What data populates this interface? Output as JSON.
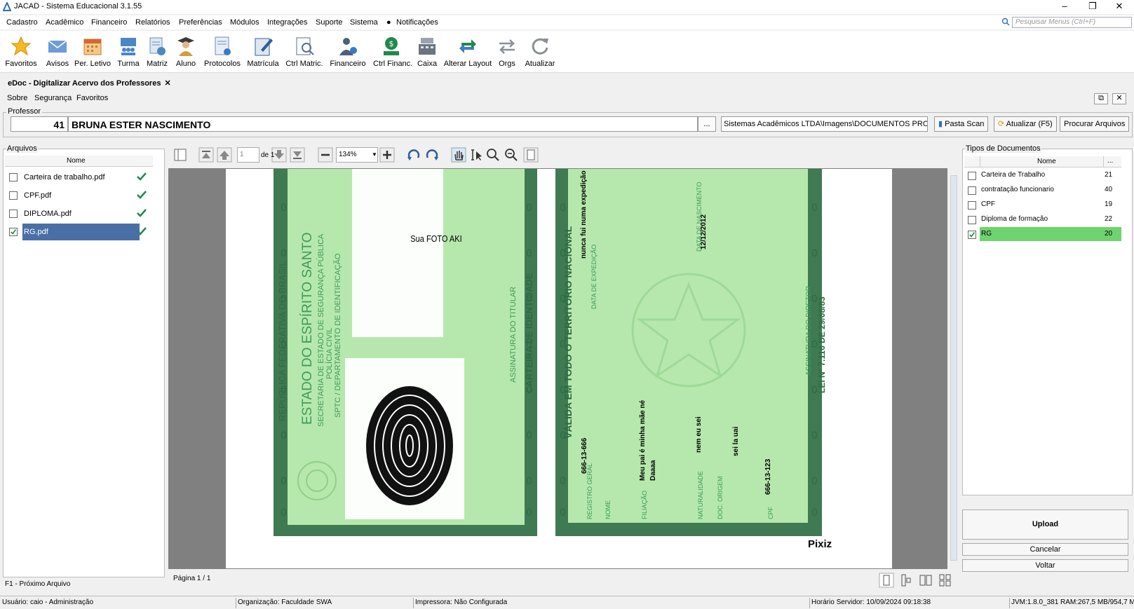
{
  "window": {
    "title": "JACAD - Sistema Educacional 3.1.55",
    "minimize": "–",
    "maximize": "❐",
    "close": "✕"
  },
  "menu": {
    "items": [
      "Cadastro",
      "Acadêmico",
      "Financeiro",
      "Relatórios",
      "Preferências",
      "Módulos",
      "Integrações",
      "Suporte",
      "Sistema",
      "Notificações"
    ],
    "search_placeholder": "Pesquisar Menus (Ctrl+F)"
  },
  "toolbar": [
    "Favoritos",
    "Avisos",
    "Per. Letivo",
    "Turma",
    "Matriz",
    "Aluno",
    "Protocolos",
    "Matrícula",
    "Ctrl Matric.",
    "Financeiro",
    "Ctrl Financ.",
    "Caixa",
    "Alterar Layout",
    "Orgs",
    "Atualizar"
  ],
  "tab": {
    "label": "eDoc - Digitalizar Acervo dos Professores",
    "close": "✕"
  },
  "submenu": [
    "Sobre",
    "Segurança",
    "Favoritos"
  ],
  "professor": {
    "legend": "Professor",
    "id": "41",
    "name": "BRUNA ESTER NASCIMENTO",
    "dots": "...",
    "path": "Sistemas Acadêmicos LTDA\\Imagens\\DOCUMENTOS PROFESSOR",
    "btn_pasta": "Pasta Scan",
    "btn_atualizar": "Atualizar (F5)",
    "btn_procurar": "Procurar Arquivos"
  },
  "arquivos": {
    "legend": "Arquivos",
    "header": "Nome",
    "files": [
      {
        "name": "Carteira de trabalho.pdf",
        "checked": false,
        "selected": false
      },
      {
        "name": "CPF.pdf",
        "checked": false,
        "selected": false
      },
      {
        "name": "DIPLOMA.pdf",
        "checked": false,
        "selected": false
      },
      {
        "name": "RG.pdf",
        "checked": true,
        "selected": true
      }
    ],
    "footer": "F1 - Próximo Arquivo"
  },
  "viewer": {
    "page": "1",
    "of": "de 1",
    "zoom": "134%",
    "page_label": "Página 1 / 1",
    "doc": {
      "foto": "Sua FOTO AKI",
      "republica": "REPÚBLICA FEDERATIVA DO BRASIL",
      "estado": "ESTADO DO ESPÍRITO SANTO",
      "secretaria": "SECRETARIA DE ESTADO DE SEGURANÇA PÚBLICA",
      "policia": "POLÍCIA CIVIL",
      "sptc": "SPTC / DEPARTAMENTO DE IDENTIFICAÇÃO",
      "assinatura_titular": "ASSINATURA DO TITULAR",
      "carteira": "CARTEIRA DE IDENTIDADE",
      "valida": "VÁLIDA EM TODO O TERRITÓRIO NACIONAL",
      "registro_lbl": "REGISTRO GERAL",
      "registro": "666-13-666",
      "nome_lbl": "NOME",
      "expedicao_lbl": "DATA DE EXPEDIÇÃO",
      "expedicao_txt": "nunca fui numa expedição",
      "nascimento_lbl": "DATA DE NASCIMENTO",
      "nascimento": "12/12/2012",
      "filiacao_lbl": "FILIAÇÃO",
      "filiacao1": "Meu pai é minha mãe né",
      "filiacao2": "Daaaa",
      "naturalidade_lbl": "NATURALIDADE",
      "naturalidade": "nem eu sei",
      "origem_lbl": "DOC. ORIGEM",
      "origem": "sei la uai",
      "cpf_lbl": "CPF",
      "cpf": "666-13-123",
      "lei": "LEI Nº 7.116 DE 29/08/83",
      "assinatura_diretor": "ASSINATURA DO DIRETOR",
      "pixiz": "Pixiz"
    }
  },
  "tipos": {
    "legend": "Tipos de Documentos",
    "header_nome": "Nome",
    "header_more": "...",
    "rows": [
      {
        "name": "Carteira de Trabalho",
        "count": "21",
        "checked": false,
        "selected": false
      },
      {
        "name": "contratação funcionario",
        "count": "40",
        "checked": false,
        "selected": false
      },
      {
        "name": "CPF",
        "count": "19",
        "checked": false,
        "selected": false
      },
      {
        "name": "Diploma de formação",
        "count": "22",
        "checked": false,
        "selected": false
      },
      {
        "name": "RG",
        "count": "20",
        "checked": true,
        "selected": true
      }
    ],
    "upload": "Upload",
    "cancelar": "Cancelar",
    "voltar": "Voltar"
  },
  "status": {
    "usuario": "Usuário: caio - Administração",
    "organizacao": "Organização: Faculdade SWA",
    "impressora": "Impressora: Não Configurada",
    "horario": "Horário Servidor: 10/09/2024 09:18:38",
    "jvm": "JVM:1.8.0_381  RAM:267,5 MB/954,7 MB"
  },
  "colors": {
    "selection_blue": "#4a6fa6",
    "selection_green": "#6fd36f",
    "doc_green": "#b6e8ad",
    "doc_border": "#3f7a52"
  }
}
